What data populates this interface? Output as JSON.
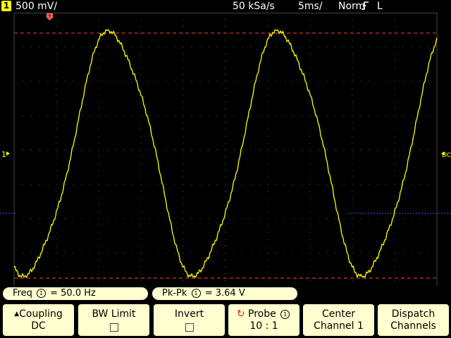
{
  "status": {
    "channel_number": "1",
    "channel_scale": "500 mV/",
    "sample_rate": "50 kSa/s",
    "time_scale": "5ms/",
    "trigger_mode": "Norm",
    "trigger_slope_icon": "rising-edge-icon",
    "trigger_coupling": "L"
  },
  "markers": {
    "trigger_position": "T",
    "channel_ground": "1",
    "trigger_level": "DC"
  },
  "measurements": {
    "freq_label": "Freq",
    "freq_source": "1",
    "freq_value": "= 50.0  Hz",
    "pkpk_label": "Pk-Pk",
    "pkpk_source": "1",
    "pkpk_value": "=  3.64  V"
  },
  "softkeys": {
    "coupling_label": "Coupling",
    "coupling_value": "DC",
    "bwlimit_label": "BW Limit",
    "invert_label": "Invert",
    "probe_label": "Probe",
    "probe_source": "1",
    "probe_value": "10 : 1",
    "center_label": "Center",
    "center_value": "Channel 1",
    "dispatch_label": "Dispatch",
    "dispatch_value": "Channels"
  },
  "signal": {
    "type": "waveform",
    "shape": "distorted sine",
    "frequency_hz": 50.0,
    "peak_to_peak_v": 3.64,
    "volts_per_div": 0.5,
    "ms_per_div": 5,
    "color": "#ffff00"
  },
  "colors": {
    "trace": "#ffff00",
    "cursor_lines": "#ff4040",
    "grid": "#555555",
    "softkey_bg": "#ffffd0",
    "ref_trace": "#5050ff"
  }
}
